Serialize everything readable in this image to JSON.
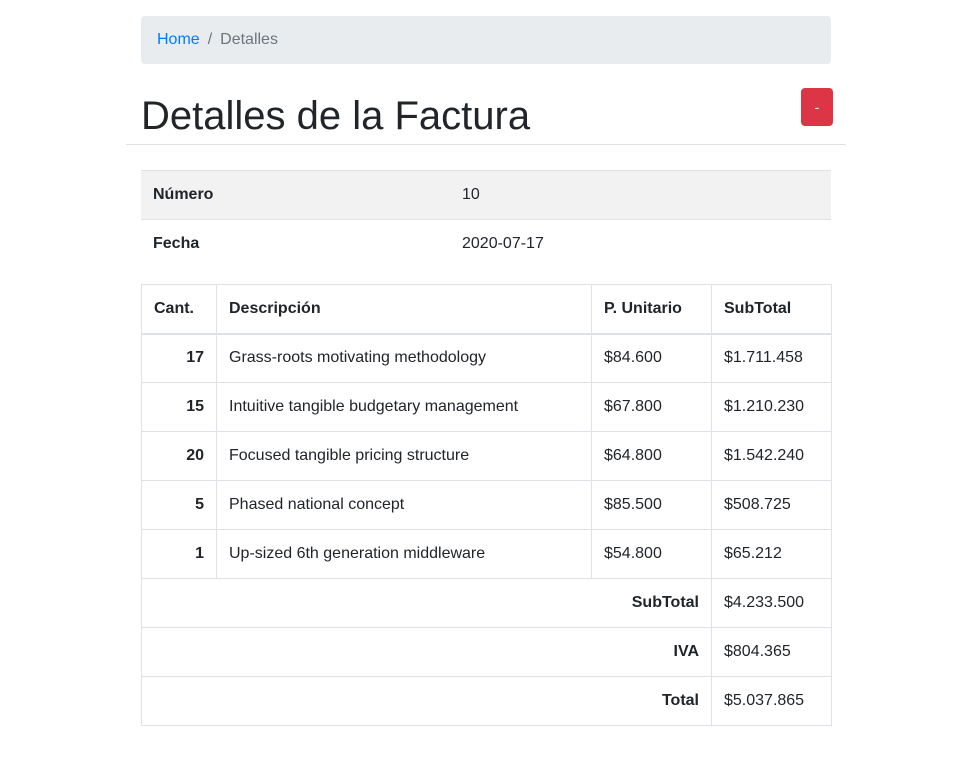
{
  "breadcrumb": {
    "home": "Home",
    "separator": "/",
    "current": "Detalles"
  },
  "page": {
    "title": "Detalles de la Factura",
    "action_button_label": "-"
  },
  "invoice": {
    "number_label": "Número",
    "number_value": "10",
    "date_label": "Fecha",
    "date_value": "2020-07-17"
  },
  "items_table": {
    "headers": [
      "Cant.",
      "Descripción",
      "P. Unitario",
      "SubTotal"
    ],
    "rows": [
      {
        "qty": "17",
        "description": "Grass-roots motivating methodology",
        "unit_price": "$84.600",
        "subtotal": "$1.711.458"
      },
      {
        "qty": "15",
        "description": "Intuitive tangible budgetary management",
        "unit_price": "$67.800",
        "subtotal": "$1.210.230"
      },
      {
        "qty": "20",
        "description": "Focused tangible pricing structure",
        "unit_price": "$64.800",
        "subtotal": "$1.542.240"
      },
      {
        "qty": "5",
        "description": "Phased national concept",
        "unit_price": "$85.500",
        "subtotal": "$508.725"
      },
      {
        "qty": "1",
        "description": "Up-sized 6th generation middleware",
        "unit_price": "$54.800",
        "subtotal": "$65.212"
      }
    ],
    "summary": [
      {
        "label": "SubTotal",
        "value": "$4.233.500"
      },
      {
        "label": "IVA",
        "value": "$804.365"
      },
      {
        "label": "Total",
        "value": "$5.037.865"
      }
    ]
  },
  "colors": {
    "link": "#007bff",
    "danger": "#dc3545",
    "breadcrumb_bg": "#e9ecef",
    "striped_row_bg": "#f2f2f2",
    "border": "#dee2e6"
  }
}
